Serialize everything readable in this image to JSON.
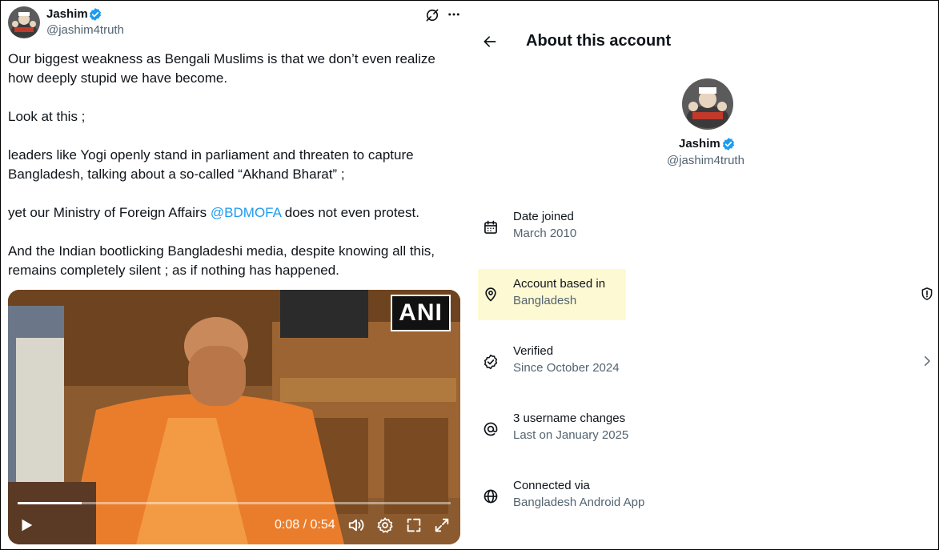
{
  "tweet": {
    "author_name": "Jashim",
    "author_handle": "@jashim4truth",
    "paragraphs": [
      "Our biggest weakness as Bengali Muslims is that we don’t even realize how deeply stupid we have become.",
      "Look at this ;",
      "leaders like Yogi openly stand in parliament and threaten to capture Bangladesh, talking about a so-called “Akhand Bharat” ;",
      "And the Indian bootlicking Bangladeshi media, despite knowing all this, remains completely silent ; as if nothing has happened."
    ],
    "mofa_prefix": "yet our Ministry of Foreign Affairs ",
    "mofa_mention": "@BDMOFA",
    "mofa_suffix": " does not even protest.",
    "video": {
      "watermark": "ANI",
      "time_current": "0:08",
      "time_total": "0:54",
      "timecode": "0:08 / 0:54",
      "progress": 0.148
    }
  },
  "about": {
    "title": "About this account",
    "profile_name": "Jashim",
    "profile_handle": "@jashim4truth",
    "rows": [
      {
        "title": "Date joined",
        "sub": "March 2010",
        "icon": "calendar-icon"
      },
      {
        "title": "Account based in",
        "sub": "Bangladesh",
        "icon": "location-pin-icon",
        "highlight": true
      },
      {
        "title": "Verified",
        "sub": "Since October 2024",
        "icon": "verified-check-icon"
      },
      {
        "title": "3 username changes",
        "sub": "Last on January 2025",
        "icon": "at-sign-icon"
      },
      {
        "title": "Connected via",
        "sub": "Bangladesh Android App",
        "icon": "globe-icon"
      }
    ]
  },
  "colors": {
    "link": "#1d9bf0",
    "verified_badge": "#1d9bf0",
    "secondary_text": "#536471",
    "highlight": "#fdf9d3"
  }
}
